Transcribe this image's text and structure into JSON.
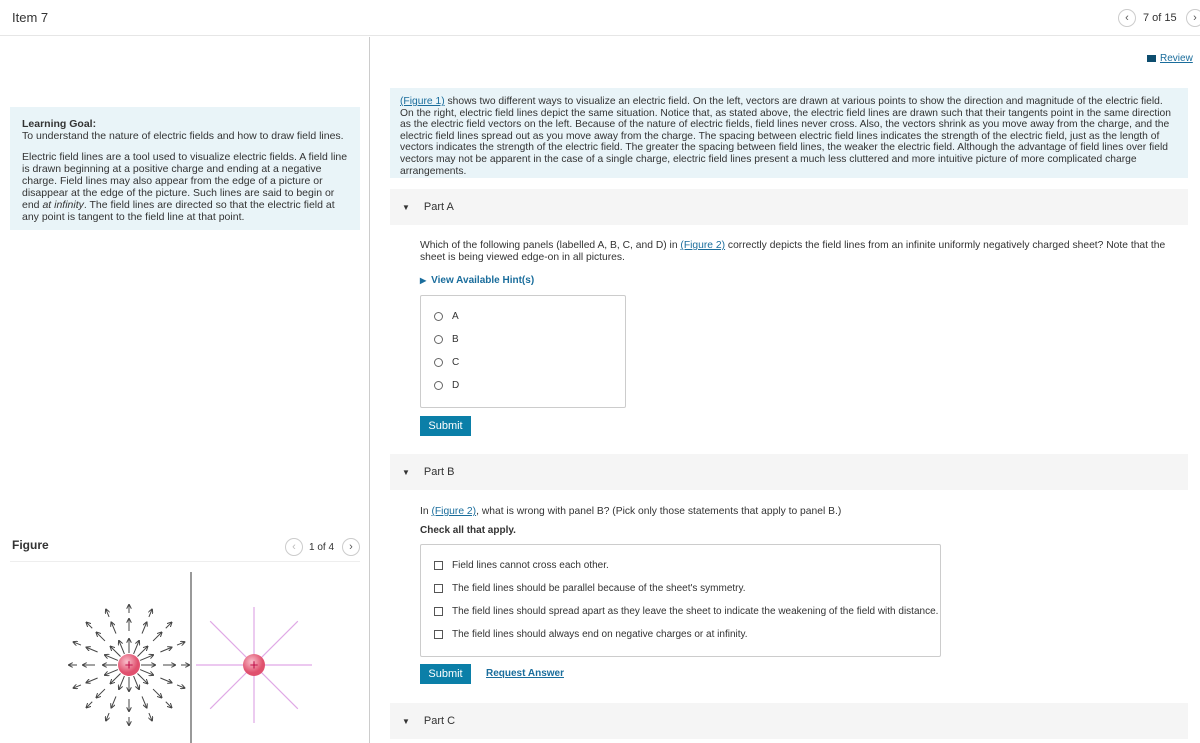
{
  "header": {
    "item_title": "Item 7",
    "pagination": "7 of 15",
    "review_label": "Review",
    "prev_icon": "chevron-left-icon",
    "next_icon": "chevron-right-icon"
  },
  "learning_goal": {
    "heading": "Learning Goal:",
    "goal_text": "To understand the nature of electric fields and how to draw field lines.",
    "body_pre": "Electric field lines are a tool used to visualize electric fields. A field line is drawn beginning at a positive charge and ending at a negative charge. Field lines may also appear from the edge of a picture or disappear at the edge of the picture. Such lines are said to begin or end ",
    "body_em": "at infinity",
    "body_post": ". The field lines are directed so that the electric field at any point is tangent to the field line at that point."
  },
  "figure": {
    "heading": "Figure",
    "pagination": "1 of 4",
    "charge_symbol": "+",
    "arrow_color": "#444444",
    "field_line_color": "#e0a8e6",
    "charge_color": "#e0506e"
  },
  "intro": {
    "link": "(Figure 1)",
    "text": " shows two different ways to visualize an electric field. On the left, vectors are drawn at various points to show the direction and magnitude of the electric field. On the right, electric field lines depict the same situation. Notice that, as stated above, the electric field lines are drawn such that their tangents point in the same direction as the electric field vectors on the left. Because of the nature of electric fields, field lines never cross. Also, the vectors shrink as you move away from the charge, and the electric field lines spread out as you move away from the charge. The spacing between electric field lines indicates the strength of the electric field, just as the length of vectors indicates the strength of the electric field. The greater the spacing between field lines, the weaker the electric field. Although the advantage of field lines over field vectors may not be apparent in the case of a single charge, electric field lines present a much less cluttered and more intuitive picture of more complicated charge arrangements."
  },
  "part_a": {
    "title": "Part A",
    "q_pre": "Which of the following panels (labelled A, B, C, and D) in ",
    "q_link": "(Figure 2)",
    "q_post": " correctly depicts the field lines from an infinite uniformly negatively charged sheet? Note that the sheet is being viewed edge-on in all pictures.",
    "hint": "View Available Hint(s)",
    "options": [
      "A",
      "B",
      "C",
      "D"
    ],
    "submit": "Submit"
  },
  "part_b": {
    "title": "Part B",
    "q_pre": "In ",
    "q_link": "(Figure 2)",
    "q_post": ", what is wrong with panel B? (Pick only those statements that apply to panel B.)",
    "instruction": "Check all that apply.",
    "options": [
      "Field lines cannot cross each other.",
      "The field lines should be parallel because of the sheet's symmetry.",
      "The field lines should spread apart as they leave the sheet to indicate the weakening of the field with distance.",
      "The field lines should always end on negative charges or at infinity."
    ],
    "submit": "Submit",
    "request_answer": "Request Answer"
  },
  "part_c": {
    "title": "Part C"
  }
}
